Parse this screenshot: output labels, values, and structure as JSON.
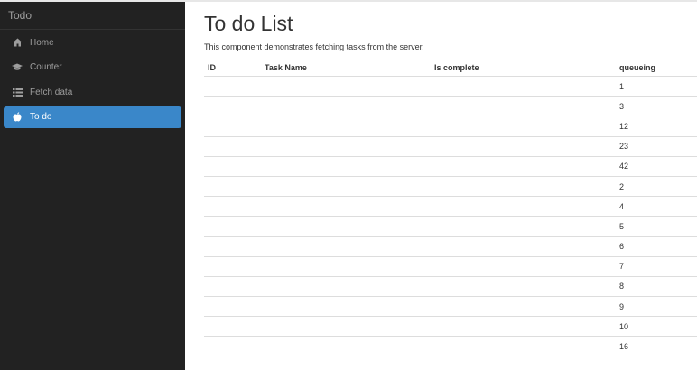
{
  "app": {
    "brand": "Todo"
  },
  "sidebar": {
    "items": [
      {
        "label": "Home",
        "icon": "home-icon",
        "active": false
      },
      {
        "label": "Counter",
        "icon": "graduation-cap-icon",
        "active": false
      },
      {
        "label": "Fetch data",
        "icon": "list-icon",
        "active": false
      },
      {
        "label": "To do",
        "icon": "apple-icon",
        "active": true
      }
    ]
  },
  "main": {
    "title": "To do List",
    "description": "This component demonstrates fetching tasks from the server.",
    "table": {
      "headers": [
        "ID",
        "Task Name",
        "Is complete",
        "queueing"
      ],
      "rows": [
        {
          "id": "",
          "name": "",
          "complete": "",
          "queueing": "1"
        },
        {
          "id": "",
          "name": "",
          "complete": "",
          "queueing": "3"
        },
        {
          "id": "",
          "name": "",
          "complete": "",
          "queueing": "12"
        },
        {
          "id": "",
          "name": "",
          "complete": "",
          "queueing": "23"
        },
        {
          "id": "",
          "name": "",
          "complete": "",
          "queueing": "42"
        },
        {
          "id": "",
          "name": "",
          "complete": "",
          "queueing": "2"
        },
        {
          "id": "",
          "name": "",
          "complete": "",
          "queueing": "4"
        },
        {
          "id": "",
          "name": "",
          "complete": "",
          "queueing": "5"
        },
        {
          "id": "",
          "name": "",
          "complete": "",
          "queueing": "6"
        },
        {
          "id": "",
          "name": "",
          "complete": "",
          "queueing": "7"
        },
        {
          "id": "",
          "name": "",
          "complete": "",
          "queueing": "8"
        },
        {
          "id": "",
          "name": "",
          "complete": "",
          "queueing": "9"
        },
        {
          "id": "",
          "name": "",
          "complete": "",
          "queueing": "10"
        },
        {
          "id": "",
          "name": "",
          "complete": "",
          "queueing": "16"
        }
      ]
    }
  },
  "colors": {
    "sidebar_bg": "#222222",
    "active_item": "#3a87c9",
    "nav_text": "#9d9d9d"
  }
}
